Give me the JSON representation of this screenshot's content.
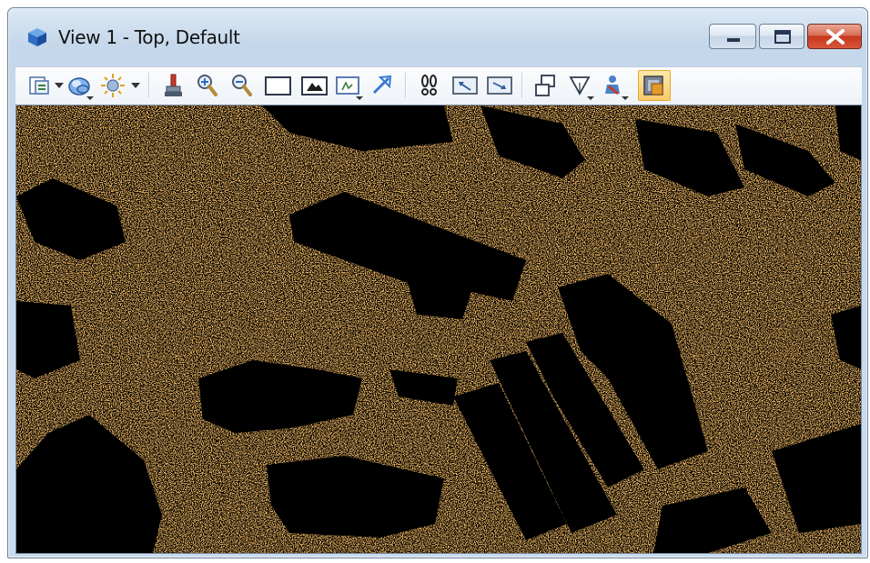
{
  "window": {
    "title": "View 1 - Top, Default",
    "icon": "cube-view-icon"
  },
  "titlebar_buttons": [
    {
      "name": "minimize",
      "icon": "minimize-icon"
    },
    {
      "name": "maximize",
      "icon": "maximize-icon"
    },
    {
      "name": "close",
      "icon": "close-icon"
    }
  ],
  "toolbar": {
    "tools": [
      {
        "name": "view-attributes",
        "icon": "view-attributes-icon",
        "dropdown": true
      },
      {
        "name": "display-style",
        "icon": "display-style-icon",
        "dropdown": true
      },
      {
        "name": "lighting",
        "icon": "sun-icon",
        "dropdown": true
      },
      {
        "name": "clip-volume",
        "icon": "brush-icon"
      },
      {
        "name": "zoom-in",
        "icon": "zoom-in-icon"
      },
      {
        "name": "zoom-out",
        "icon": "zoom-out-icon"
      },
      {
        "name": "window-area",
        "icon": "window-area-icon"
      },
      {
        "name": "fit-view",
        "icon": "fit-view-icon"
      },
      {
        "name": "rotate-view",
        "icon": "rotate-view-icon",
        "dropdown": true
      },
      {
        "name": "pan-view",
        "icon": "pan-arrow-icon"
      },
      {
        "name": "walk",
        "icon": "footprints-icon"
      },
      {
        "name": "view-previous",
        "icon": "view-previous-icon"
      },
      {
        "name": "view-next",
        "icon": "view-next-icon"
      },
      {
        "name": "copy-view",
        "icon": "copy-view-icon"
      },
      {
        "name": "view-display-mode",
        "icon": "triangle-view-icon",
        "dropdown": true
      },
      {
        "name": "camera",
        "icon": "camera-icon",
        "dropdown": true
      },
      {
        "name": "standard-views",
        "icon": "cube-view-icon",
        "active": true
      }
    ]
  },
  "viewport": {
    "description_color": "#e07a1f",
    "background_color": "#000000"
  },
  "colors": {
    "point_cloud": "#e07a1f",
    "viewport_bg": "#000000",
    "titlebar": "#c5d7ea",
    "close_button": "#c5381c"
  }
}
